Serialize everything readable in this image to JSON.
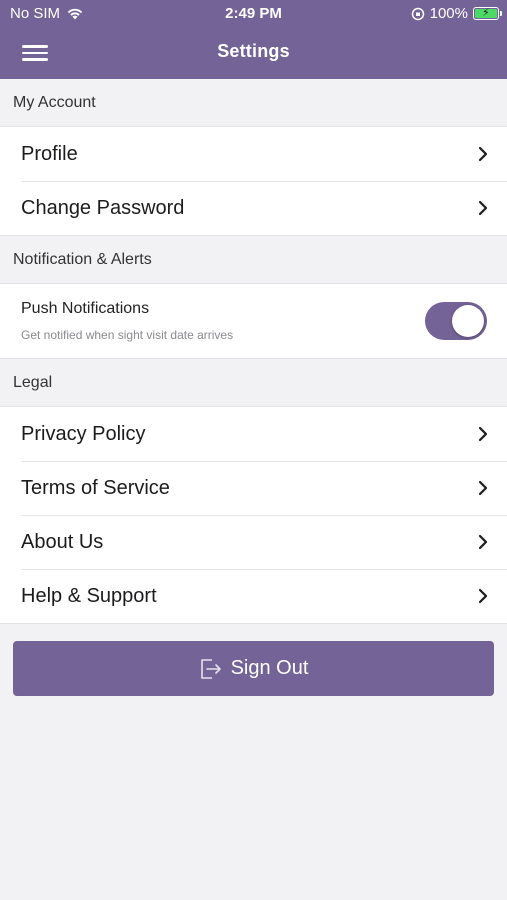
{
  "status_bar": {
    "carrier": "No SIM",
    "time": "2:49 PM",
    "battery": "100%"
  },
  "nav": {
    "title": "Settings"
  },
  "sections": {
    "account": {
      "header": "My Account",
      "items": [
        "Profile",
        "Change Password"
      ]
    },
    "notifications": {
      "header": "Notification & Alerts",
      "push_title": "Push Notifications",
      "push_subtitle": "Get notified when sight visit date arrives",
      "push_enabled": true
    },
    "legal": {
      "header": "Legal",
      "items": [
        "Privacy Policy",
        "Terms of Service",
        "About Us",
        "Help & Support"
      ]
    }
  },
  "signout": {
    "label": "Sign Out"
  },
  "colors": {
    "accent": "#746397",
    "background": "#f2f2f4"
  }
}
